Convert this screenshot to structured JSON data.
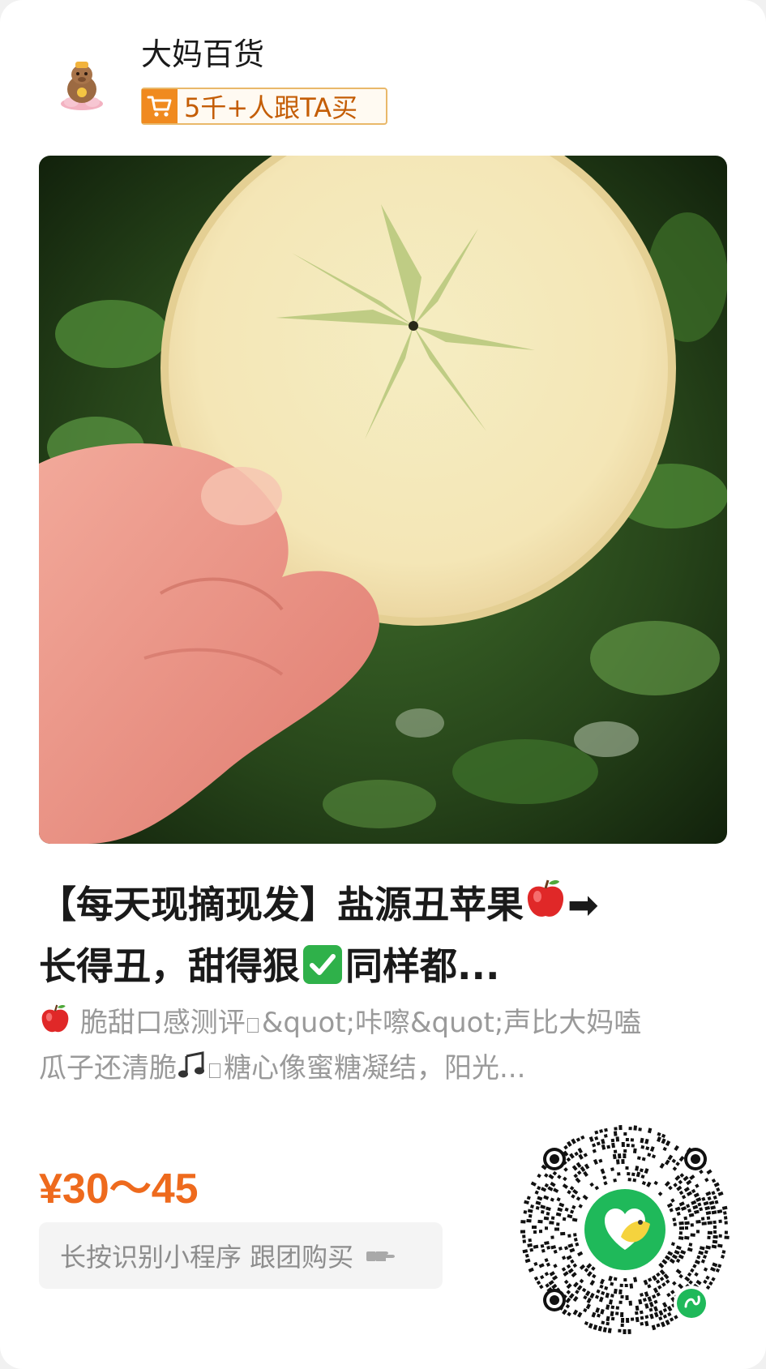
{
  "shop": {
    "name": "大妈百货",
    "buyers_badge": "5千+人跟TA买"
  },
  "product": {
    "title_line1": "【每天现摘现发】盐源丑苹果",
    "title_arrow": "➡",
    "title_line2_a": "长得丑，甜得狠",
    "title_line2_b": "同样都...",
    "desc_line1_a": "脆甜口感测评",
    "desc_line1_b": "&quot;咔嚓&quot;声比大妈嗑",
    "desc_line2_a": "瓜子还清脆",
    "desc_line2_b": "糖心像蜜糖凝结，阳光...",
    "price": "¥30～45"
  },
  "action": {
    "hint": "长按识别小程序 跟团购买"
  },
  "icons": {
    "avatar": "cartoon-avatar-icon",
    "cart": "shopping-cart-icon",
    "apple": "red-apple-emoji",
    "check": "check-mark-emoji",
    "note": "music-note-emoji",
    "hand": "pointing-hand-icon",
    "qr": "mini-program-qr-code"
  },
  "colors": {
    "price": "#ee6a1d",
    "badge_border": "#e9b86a",
    "badge_text": "#c45d05",
    "cart_bg": "#f08a1f",
    "qr_green": "#1fb95a",
    "qr_yellow": "#f5d33e"
  }
}
